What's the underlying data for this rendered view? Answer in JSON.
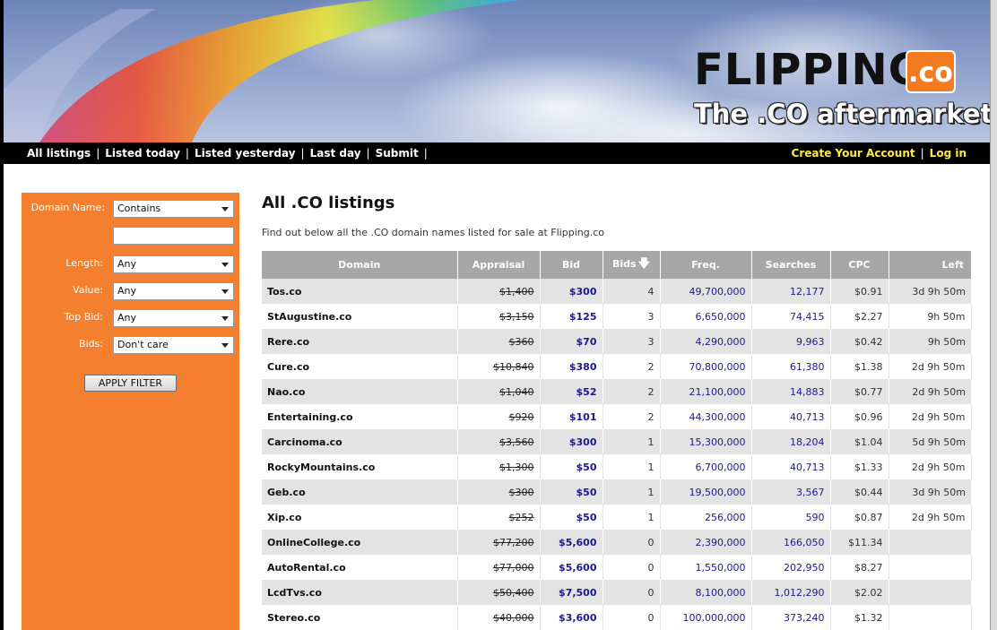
{
  "brand": {
    "logo_word": "FLIPPING",
    "logo_tld": ".co",
    "tagline": "The .CO aftermarket"
  },
  "nav": {
    "left": [
      "All listings",
      "Listed today",
      "Listed yesterday",
      "Last day",
      "Submit"
    ],
    "create_account": "Create Your Account",
    "login": "Log in",
    "separator": "|"
  },
  "filter": {
    "domain_name_label": "Domain Name:",
    "domain_match": "Contains",
    "domain_text": "",
    "length_label": "Length:",
    "length_value": "Any",
    "value_label": "Value:",
    "value_value": "Any",
    "top_bid_label": "Top Bid:",
    "top_bid_value": "Any",
    "bids_label": "Bids:",
    "bids_value": "Don't care",
    "apply_label": "APPLY FILTER"
  },
  "page": {
    "title": "All .CO listings",
    "subtitle": "Find out below all the .CO domain names listed for sale at Flipping.co"
  },
  "table": {
    "headers": {
      "domain": "Domain",
      "appraisal": "Appraisal",
      "bid": "Bid",
      "bids": "Bids",
      "freq": "Freq.",
      "searches": "Searches",
      "cpc": "CPC",
      "left": "Left"
    },
    "rows": [
      {
        "domain": "Tos.co",
        "appraisal": "$1,400",
        "bid": "$300",
        "bids": "4",
        "freq": "49,700,000",
        "searches": "12,177",
        "cpc": "$0.91",
        "left": "3d 9h 50m"
      },
      {
        "domain": "StAugustine.co",
        "appraisal": "$3,150",
        "bid": "$125",
        "bids": "3",
        "freq": "6,650,000",
        "searches": "74,415",
        "cpc": "$2.27",
        "left": "9h 50m"
      },
      {
        "domain": "Rere.co",
        "appraisal": "$360",
        "bid": "$70",
        "bids": "3",
        "freq": "4,290,000",
        "searches": "9,963",
        "cpc": "$0.42",
        "left": "9h 50m"
      },
      {
        "domain": "Cure.co",
        "appraisal": "$10,840",
        "bid": "$380",
        "bids": "2",
        "freq": "70,800,000",
        "searches": "61,380",
        "cpc": "$1.38",
        "left": "2d 9h 50m"
      },
      {
        "domain": "Nao.co",
        "appraisal": "$1,040",
        "bid": "$52",
        "bids": "2",
        "freq": "21,100,000",
        "searches": "14,883",
        "cpc": "$0.77",
        "left": "2d 9h 50m"
      },
      {
        "domain": "Entertaining.co",
        "appraisal": "$920",
        "bid": "$101",
        "bids": "2",
        "freq": "44,300,000",
        "searches": "40,713",
        "cpc": "$0.96",
        "left": "2d 9h 50m"
      },
      {
        "domain": "Carcinoma.co",
        "appraisal": "$3,560",
        "bid": "$300",
        "bids": "1",
        "freq": "15,300,000",
        "searches": "18,204",
        "cpc": "$1.04",
        "left": "5d 9h 50m"
      },
      {
        "domain": "RockyMountains.co",
        "appraisal": "$1,300",
        "bid": "$50",
        "bids": "1",
        "freq": "6,700,000",
        "searches": "40,713",
        "cpc": "$1.33",
        "left": "2d 9h 50m"
      },
      {
        "domain": "Geb.co",
        "appraisal": "$300",
        "bid": "$50",
        "bids": "1",
        "freq": "19,500,000",
        "searches": "3,567",
        "cpc": "$0.44",
        "left": "3d 9h 50m"
      },
      {
        "domain": "Xip.co",
        "appraisal": "$252",
        "bid": "$50",
        "bids": "1",
        "freq": "256,000",
        "searches": "590",
        "cpc": "$0.87",
        "left": "2d 9h 50m"
      },
      {
        "domain": "OnlineCollege.co",
        "appraisal": "$77,200",
        "bid": "$5,600",
        "bids": "0",
        "freq": "2,390,000",
        "searches": "166,050",
        "cpc": "$11.34",
        "left": ""
      },
      {
        "domain": "AutoRental.co",
        "appraisal": "$77,000",
        "bid": "$5,600",
        "bids": "0",
        "freq": "1,550,000",
        "searches": "202,950",
        "cpc": "$8.27",
        "left": ""
      },
      {
        "domain": "LcdTvs.co",
        "appraisal": "$50,400",
        "bid": "$7,500",
        "bids": "0",
        "freq": "8,100,000",
        "searches": "1,012,290",
        "cpc": "$2.02",
        "left": ""
      },
      {
        "domain": "Stereo.co",
        "appraisal": "$40,000",
        "bid": "$3,600",
        "bids": "0",
        "freq": "100,000,000",
        "searches": "373,240",
        "cpc": "$1.32",
        "left": ""
      }
    ]
  },
  "colors": {
    "accent_orange": "#f47f2f",
    "link_blue": "#1a1a8c",
    "nav_highlight": "#ffe94a",
    "header_gray": "#a7a7a7"
  }
}
